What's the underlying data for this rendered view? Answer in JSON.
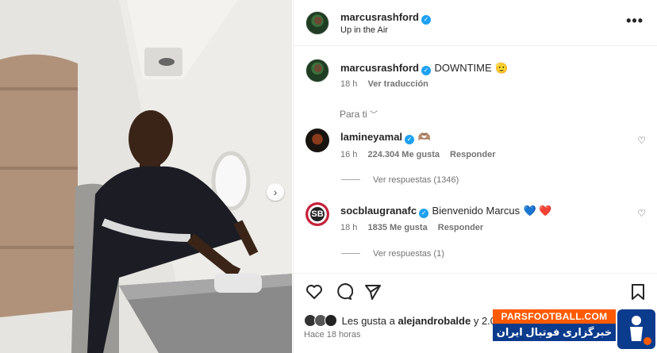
{
  "post": {
    "author": "marcusrashford",
    "caption": "Up in the Air"
  },
  "comments": [
    {
      "user": "marcusrashford",
      "text": "DOWNTIME",
      "emoji": "🫡",
      "time": "18 h",
      "action": "Ver traducción"
    },
    {
      "user": "lamineyamal",
      "text": "",
      "emoji": "🫶🏽",
      "time": "16 h",
      "likes": "224.304 Me gusta",
      "reply": "Responder",
      "replies": "Ver respuestas (1346)"
    },
    {
      "user": "socblaugranafc",
      "text": "Bienvenido Marcus",
      "emoji": "💙 ❤️",
      "time": "18 h",
      "likes": "1835 Me gusta",
      "reply": "Responder",
      "replies": "Ver respuestas (1)"
    }
  ],
  "sort_label": "Para ti",
  "likes_summary": {
    "prefix": "Les gusta a",
    "user": "alejandrobalde",
    "suffix": "y 2.08"
  },
  "time_ago": "Hace 18 horas",
  "watermark": {
    "top": "PARSFOOTBALL.COM",
    "bottom": "خبرگزاری فوتبال ایران"
  },
  "icons": [
    "heart-icon",
    "comment-icon",
    "share-icon",
    "bookmark-icon",
    "more-icon",
    "verified-icon",
    "chevron-down-icon",
    "next-arrow-icon"
  ],
  "colors": {
    "verified": "#1da1f2",
    "watermark_orange": "#ff5a00",
    "watermark_blue": "#0b3b8c"
  }
}
